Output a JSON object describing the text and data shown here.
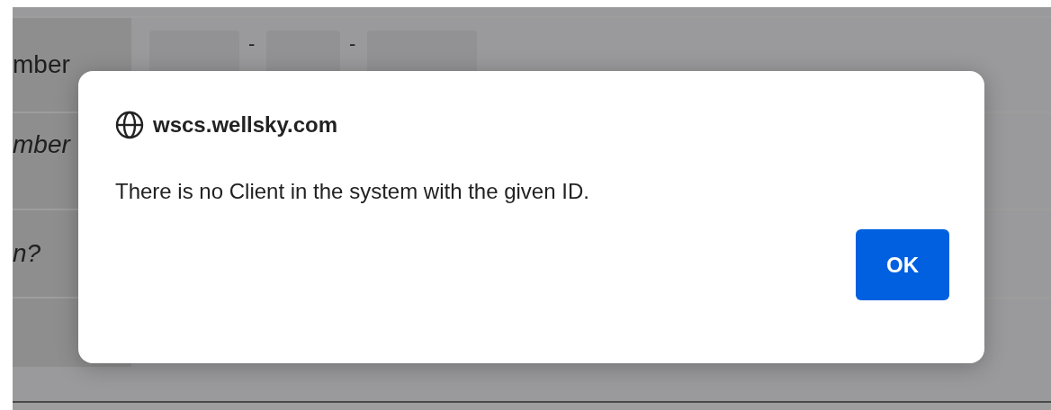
{
  "form": {
    "rows": [
      {
        "label": "mber",
        "kind": "plain",
        "segments": [
          {
            "kind": "field"
          },
          {
            "kind": "separator",
            "text": "-"
          },
          {
            "kind": "field"
          },
          {
            "kind": "separator",
            "text": "-"
          },
          {
            "kind": "field"
          }
        ]
      },
      {
        "label": "mber",
        "kind": "italic"
      },
      {
        "label": "n?",
        "kind": "italic"
      },
      {}
    ]
  },
  "dialog": {
    "origin": "wscs.wellsky.com",
    "message": "There is no Client in the system with the given ID.",
    "buttons": [
      {
        "label": "OK",
        "primary": true
      }
    ]
  }
}
